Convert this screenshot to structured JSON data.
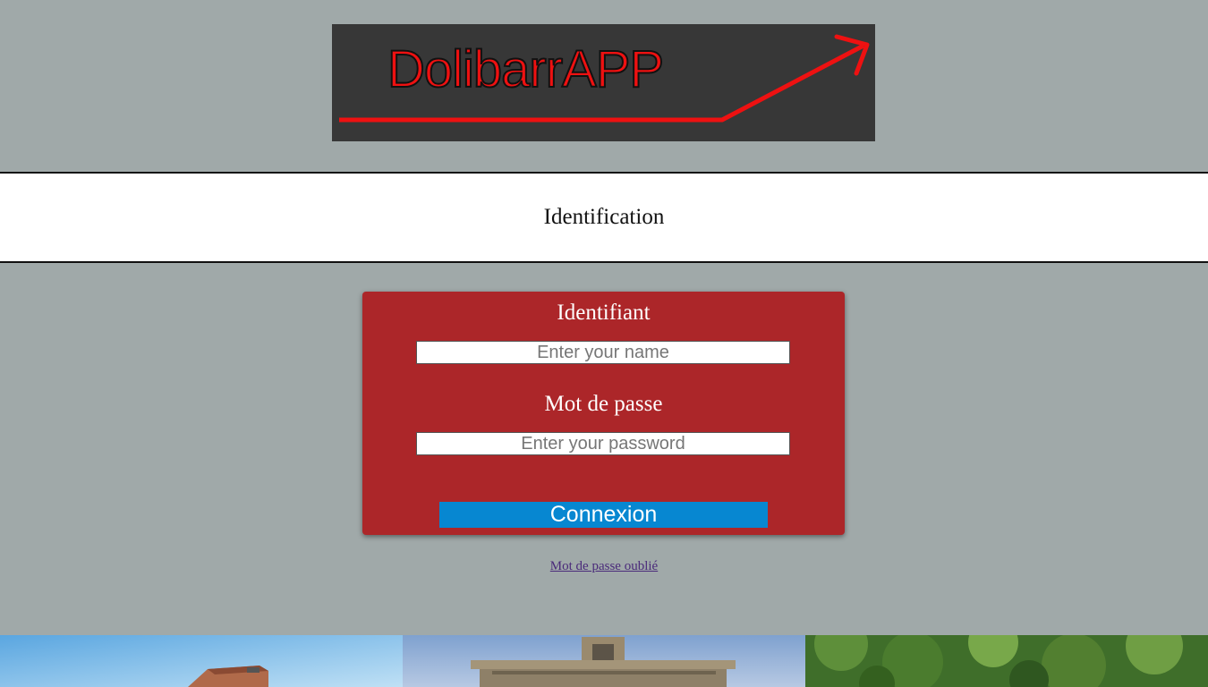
{
  "logo": {
    "text": "DolibarrAPP",
    "background": "#373737",
    "accent": "#ee1111"
  },
  "header": {
    "title": "Identification"
  },
  "login": {
    "username_label": "Identifiant",
    "username_placeholder": "Enter your name",
    "password_label": "Mot de passe",
    "password_placeholder": "Enter your password",
    "submit_label": "Connexion",
    "card_color": "#ac2629",
    "button_color": "#0787d1"
  },
  "forgot_password": {
    "label": "Mot de passe oublié"
  },
  "photos": [
    {
      "name": "building-photo"
    },
    {
      "name": "facade-photo"
    },
    {
      "name": "trees-photo"
    }
  ]
}
